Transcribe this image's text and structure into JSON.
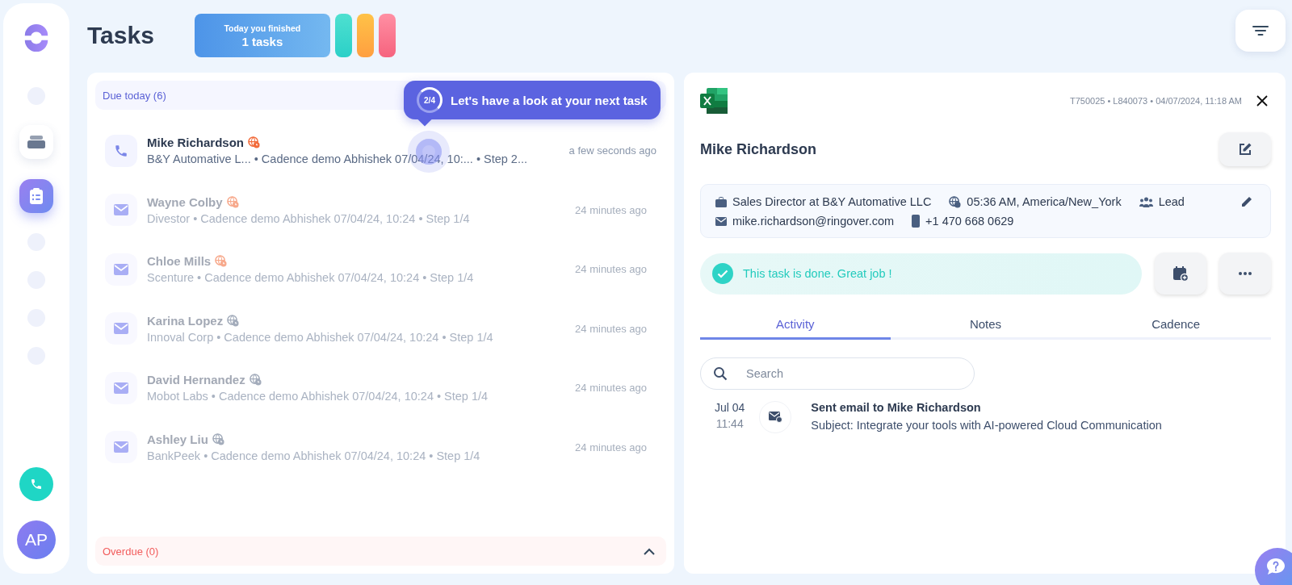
{
  "sidebar": {
    "items": [
      {
        "kind": "dot",
        "selected": false
      },
      {
        "kind": "stack",
        "selected": false
      },
      {
        "kind": "clipboard",
        "selected": true
      },
      {
        "kind": "dot",
        "selected": false
      },
      {
        "kind": "dot",
        "selected": false
      },
      {
        "kind": "dot",
        "selected": false
      },
      {
        "kind": "dot",
        "selected": false
      }
    ],
    "avatar": "AP"
  },
  "header": {
    "title": "Tasks",
    "finished": {
      "label": "Today you finished",
      "count": "1 tasks"
    }
  },
  "task_list": {
    "due_today": "Due today (6)",
    "overdue": "Overdue (0)",
    "overdue_expanded": true,
    "tooltip": {
      "step": "2/4",
      "text": "Let's have a look at your next task"
    },
    "tasks": [
      {
        "kind": "call",
        "name": "Mike Richardson",
        "company": "B&Y Automative L...",
        "cadence": "• Cadence demo Abhishek 07/04/24, 10:...",
        "step": "• Step 2...",
        "time": "a few seconds ago",
        "dimmed": false,
        "color": "#f26b3a"
      },
      {
        "kind": "email",
        "name": "Wayne Colby",
        "company": "Divestor",
        "cadence": "• Cadence demo Abhishek 07/04/24, 10:24",
        "step": "• Step 1/4",
        "time": "24 minutes ago",
        "dimmed": true,
        "color": "#f7a98c"
      },
      {
        "kind": "email",
        "name": "Chloe Mills",
        "company": "Scenture",
        "cadence": "• Cadence demo Abhishek 07/04/24, 10:24",
        "step": "• Step 1/4",
        "time": "24 minutes ago",
        "dimmed": true,
        "color": "#f7a98c"
      },
      {
        "kind": "email",
        "name": "Karina Lopez",
        "company": "Innoval Corp",
        "cadence": "• Cadence demo Abhishek 07/04/24, 10:24",
        "step": "• Step 1/4",
        "time": "24 minutes ago",
        "dimmed": true,
        "color": "#a3acbb"
      },
      {
        "kind": "email",
        "name": "David Hernandez",
        "company": "Mobot Labs",
        "cadence": "• Cadence demo Abhishek 07/04/24, 10:24",
        "step": "• Step 1/4",
        "time": "24 minutes ago",
        "dimmed": true,
        "color": "#a3acbb"
      },
      {
        "kind": "email",
        "name": "Ashley Liu",
        "company": "BankPeek",
        "cadence": "• Cadence demo Abhishek 07/04/24, 10:24",
        "step": "• Step 1/4",
        "time": "24 minutes ago",
        "dimmed": true,
        "color": "#a3acbb"
      }
    ]
  },
  "detail": {
    "meta": "T750025 • L840073 • 04/07/2024, 11:18 AM",
    "name": "Mike Richardson",
    "info": {
      "job": "Sales Director at B&Y Automative LLC",
      "timezone": "05:36 AM, America/New_York",
      "type": "Lead",
      "email": "mike.richardson@ringover.com",
      "phone": "+1 470 668 0629"
    },
    "done_message": "This task is done. Great job !",
    "tabs": [
      {
        "label": "Activity",
        "selected": true
      },
      {
        "label": "Notes",
        "selected": false
      },
      {
        "label": "Cadence",
        "selected": false
      }
    ],
    "search": {
      "placeholder": "Search"
    },
    "activities": [
      {
        "date": "Jul 04",
        "time": "11:44",
        "title": "Sent email to Mike Richardson",
        "subject": "Subject: Integrate your tools with AI-powered Cloud Communication"
      }
    ]
  }
}
